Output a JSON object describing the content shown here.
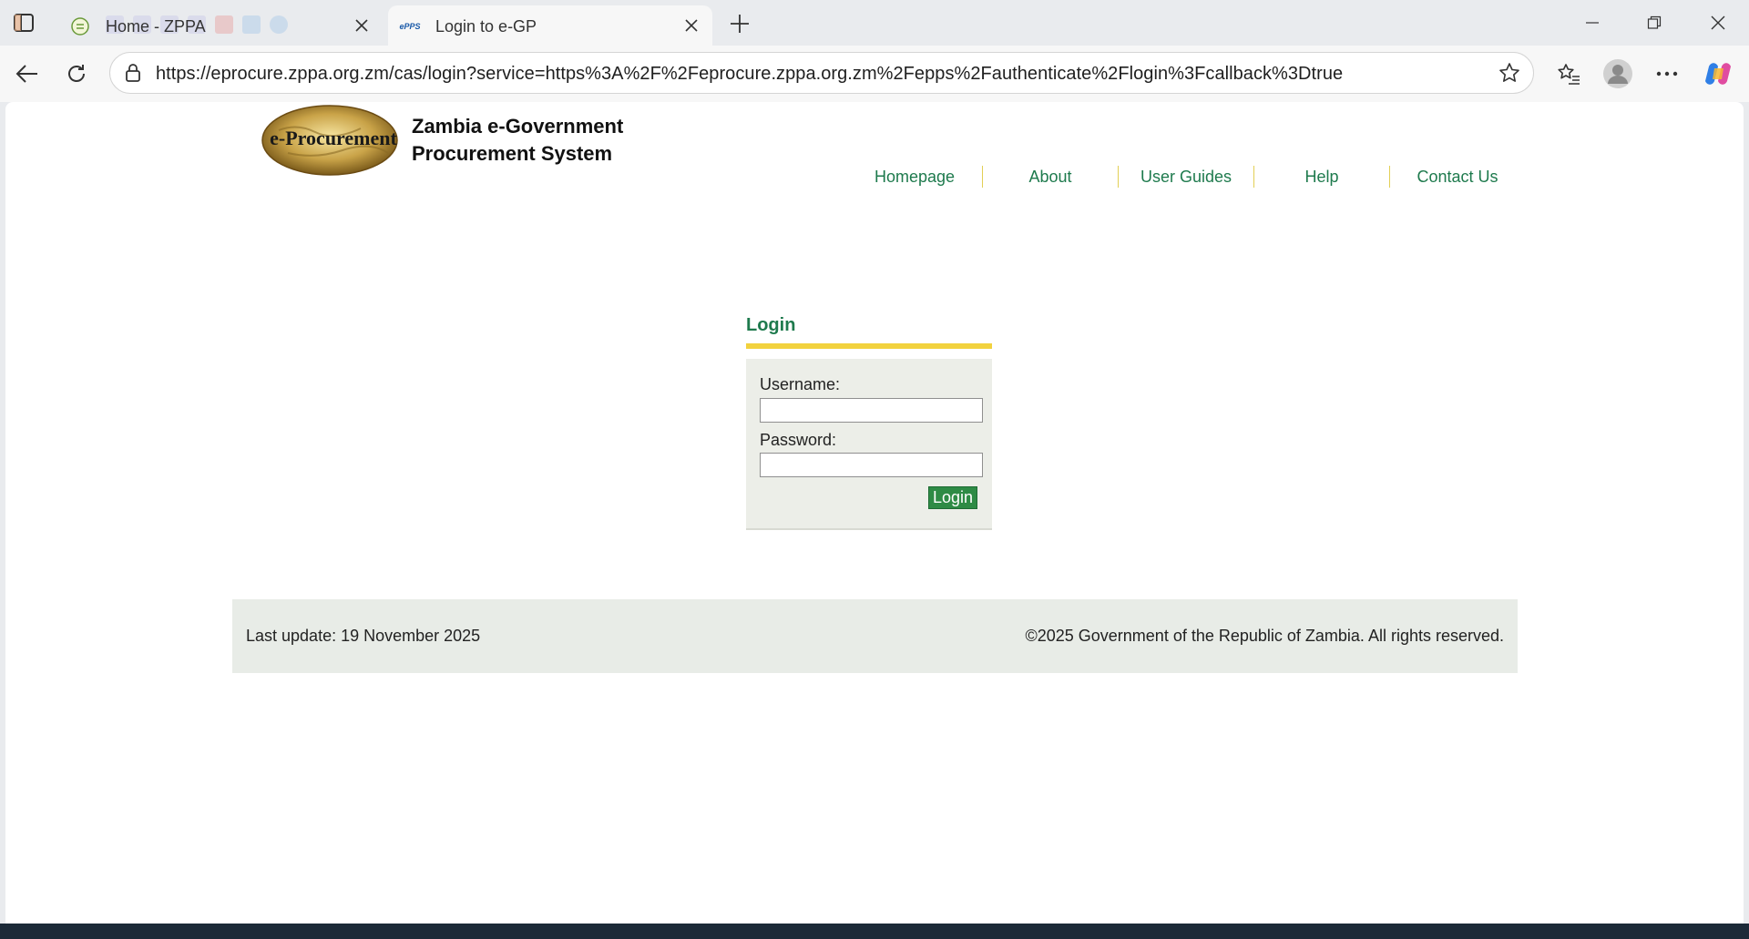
{
  "browser": {
    "tabs": [
      {
        "title": "Home - ZPPA",
        "active": false
      },
      {
        "title": "Login to e-GP",
        "active": true
      }
    ],
    "address_url": "https://eprocure.zppa.org.zm/cas/login?service=https%3A%2F%2Feprocure.zppa.org.zm%2Fepps%2Fauthenticate%2Flogin%3Fcallback%3Dtrue"
  },
  "site": {
    "title_line1": "Zambia e-Government",
    "title_line2": "Procurement System",
    "logo_text": "e-Procurement",
    "favicon_text": "ePPS"
  },
  "nav": {
    "items": [
      "Homepage",
      "About",
      "User Guides",
      "Help",
      "Contact Us"
    ]
  },
  "login": {
    "heading": "Login",
    "username_label": "Username:",
    "username_value": "",
    "password_label": "Password:",
    "password_value": "",
    "button_label": "Login"
  },
  "footer": {
    "last_update": "Last update: 19 November 2025",
    "copyright": "©2025 Government of the Republic of Zambia. All rights reserved."
  },
  "colors": {
    "accent_green": "#1e7a4d",
    "underline_yellow": "#f2d23e",
    "button_green": "#2e8b45"
  }
}
